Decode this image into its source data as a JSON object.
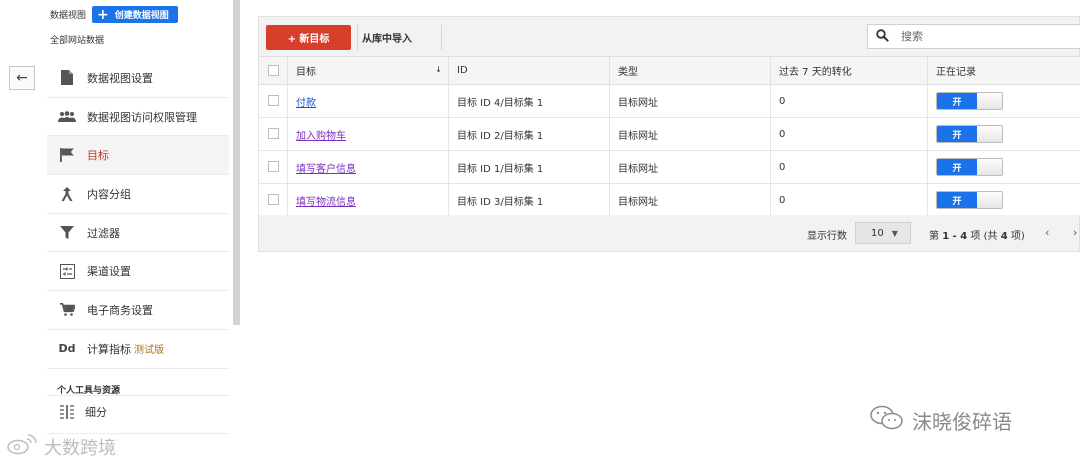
{
  "view": {
    "label": "数据视图",
    "create_button": "创建数据视图",
    "create_plus": "+",
    "name": "全部网站数据"
  },
  "nav": {
    "back_glyph": "←",
    "items": [
      {
        "label": "数据视图设置",
        "icon": "document-icon"
      },
      {
        "label": "数据视图访问权限管理",
        "icon": "users-icon"
      },
      {
        "label": "目标",
        "icon": "flag-icon",
        "active": true
      },
      {
        "label": "内容分组",
        "icon": "content-grouping-icon"
      },
      {
        "label": "过滤器",
        "icon": "filter-icon"
      },
      {
        "label": "渠道设置",
        "icon": "channel-settings-icon"
      },
      {
        "label": "电子商务设置",
        "icon": "cart-icon"
      },
      {
        "label": "计算指标",
        "icon": "calculated-metric-icon",
        "icon_text": "Dd",
        "badge": "测试版"
      }
    ],
    "section_title": "个人工具与资源",
    "sub_items": [
      {
        "label": "细分",
        "icon": "segments-icon"
      }
    ]
  },
  "toolbar": {
    "new_goal": "+ 新目标",
    "import": "从库中导入",
    "search_placeholder": "搜索"
  },
  "table": {
    "headers": [
      "目标",
      "ID",
      "类型",
      "过去 7 天的转化",
      "正在记录"
    ],
    "sort_glyph": "↓",
    "rows": [
      {
        "goal": "付款",
        "id": "目标 ID 4/目标集 1",
        "type": "目标网址",
        "conversions": "0",
        "recording": "开"
      },
      {
        "goal": "加入购物车",
        "id": "目标 ID 2/目标集 1",
        "type": "目标网址",
        "conversions": "0",
        "recording": "开"
      },
      {
        "goal": "填写客户信息",
        "id": "目标 ID 1/目标集 1",
        "type": "目标网址",
        "conversions": "0",
        "recording": "开"
      },
      {
        "goal": "填写物流信息",
        "id": "目标 ID 3/目标集 1",
        "type": "目标网址",
        "conversions": "0",
        "recording": "开"
      }
    ]
  },
  "pager": {
    "rows_label": "显示行数",
    "rows_value": "10",
    "range_prefix": "第",
    "range": "1 - 4",
    "range_mid": "项 (共",
    "total": "4",
    "range_suffix": "项)",
    "prev": "‹",
    "next": "›"
  },
  "watermarks": {
    "right": "沫晓俊碎语",
    "left": "大数跨境"
  },
  "colors": {
    "accent_red": "#d73f2c",
    "accent_blue": "#1a73e8",
    "link": "#1155cc",
    "visited": "#7a2fbf"
  }
}
